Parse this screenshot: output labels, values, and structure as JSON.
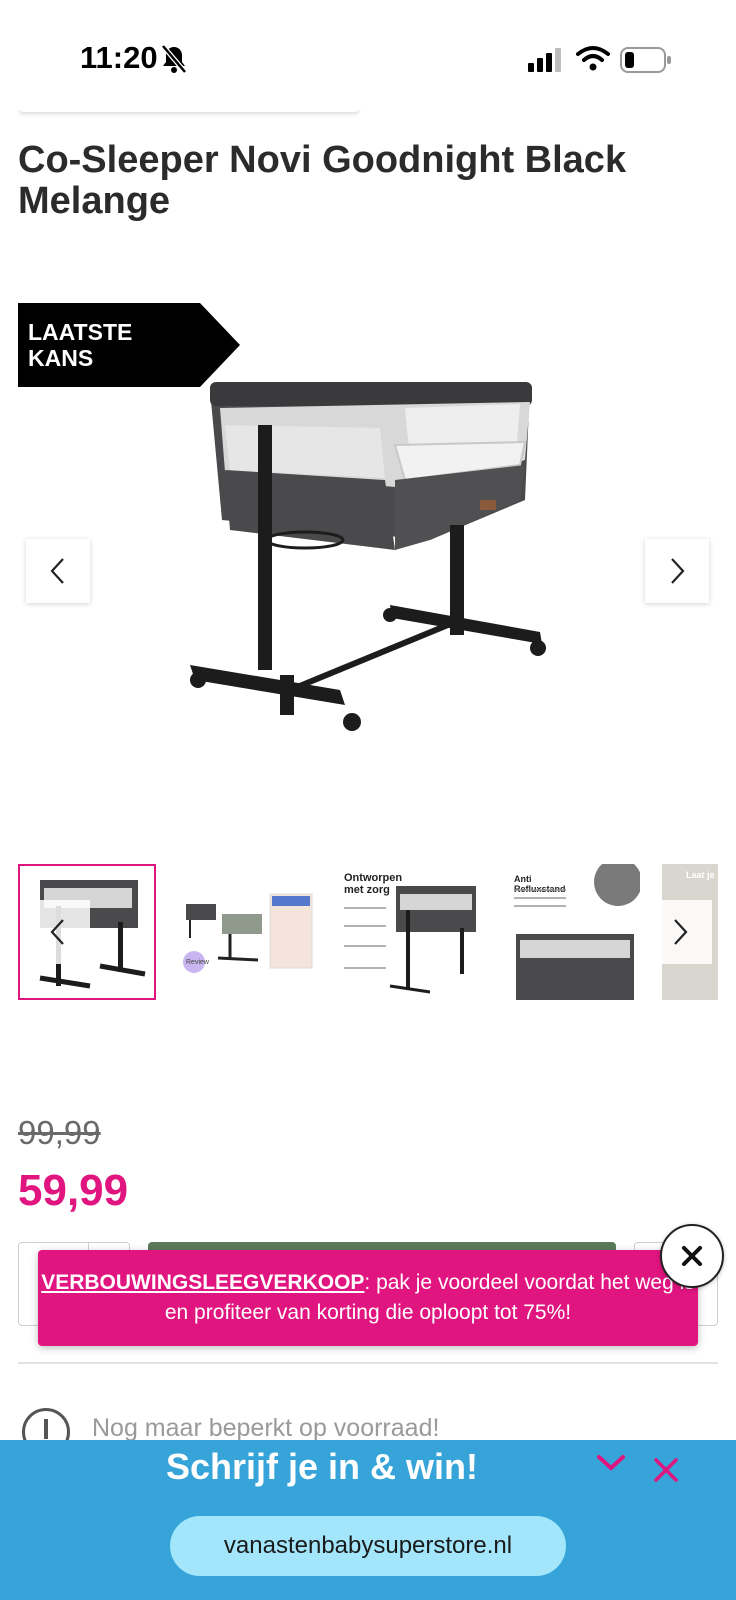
{
  "status_bar": {
    "time": "11:20",
    "icons": [
      "bell-slash-icon",
      "cellular-signal-icon",
      "wifi-icon",
      "battery-icon"
    ]
  },
  "product": {
    "title": "Co-Sleeper Novi Goodnight Black Melange",
    "badge": "LAATSTE KANS",
    "old_price": "99,99",
    "price": "59,99",
    "stock_message": "Nog maar beperkt op voorraad!"
  },
  "thumbnails": {
    "selected_index": 0,
    "items": [
      {
        "caption": ""
      },
      {
        "caption": "Review"
      },
      {
        "caption": "Ontworpen met zorg"
      },
      {
        "caption": "Anti Refluxstand"
      },
      {
        "caption": "Laat je"
      }
    ]
  },
  "promo_banner": {
    "link_text": "VERBOUWINGSLEEGVERKOOP",
    "message": ": pak je voordeel voordat het weg is en profiteer van korting die oploopt tot 75%!"
  },
  "signup_bar": {
    "title": "Schrijf je in & win!",
    "url": "vanastenbabysuperstore.nl"
  },
  "colors": {
    "brand_pink": "#e0157f",
    "signup_blue": "#36a3d9",
    "url_pill": "#a3e6fb",
    "badge_black": "#000000"
  }
}
